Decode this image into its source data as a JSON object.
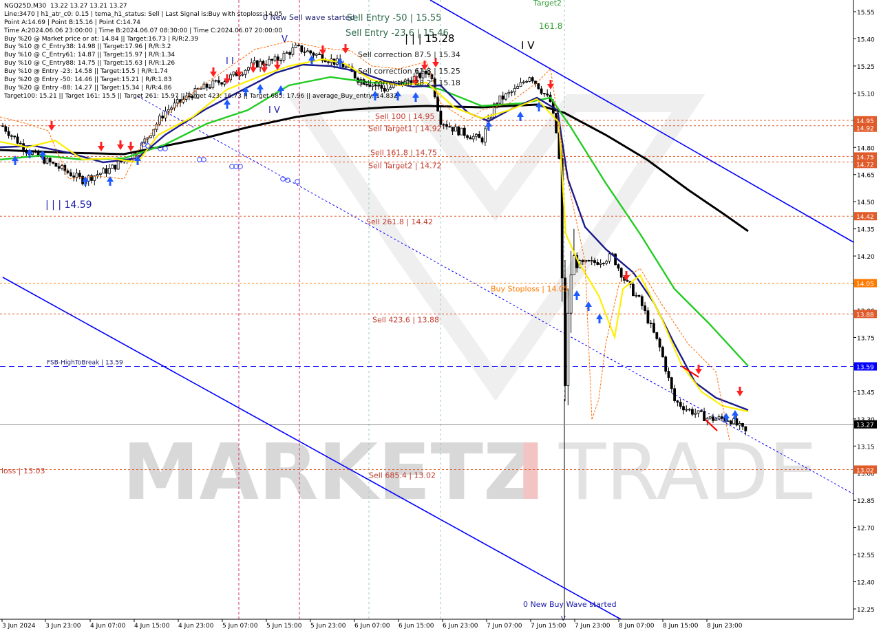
{
  "header": {
    "symbol": "NGQ25D,M30",
    "ohlc": "13.22 13.27 13.21 13.27",
    "lines": [
      "Line:3470 | h1_atr_c0: 0.15 | tema_h1_status: Sell | Last Signal is:Buy with stoploss:14.05",
      "Point A:14.69 | Point B:15.16 | Point C:14.74",
      "Time A:2024.06.06 23:00:00 | Time B:2024.06.07 08:30:00 | Time C:2024.06.07 20:00:00",
      "Buy %20 @ Market price or at: 14.84 || Target:16.73 | R/R:2.39",
      "Buy %10 @ C_Entry38: 14.98 || Target:17.96 | R/R:3.2",
      "Buy %10 @ C_Entry61: 14.87 || Target:15.97 | R/R:1.34",
      "Buy %10 @ C_Entry88: 14.75 || Target:15.63 | R/R:1.26",
      "Buy %10 @ Entry -23: 14.58 || Target:15.5 | R/R:1.74",
      "Buy %20 @ Entry -50: 14.46 || Target:15.21 | R/R:1.83",
      "Buy %20 @ Entry -88: 14.27 || Target:15.34 | R/R:4.86",
      "Target100: 15.21 || Target 161: 15.5 || Target 261: 15.97 || Target 423: 16.73 || Target 685: 17.96 || average_Buy_entry: 14.832"
    ]
  },
  "watermark": {
    "left": "MARKETZ",
    "i": "I",
    "right": "TRADE"
  },
  "y_axis": {
    "ticks": [
      "15.55",
      "15.40",
      "15.25",
      "15.10",
      "14.95",
      "14.80",
      "14.65",
      "14.50",
      "14.35",
      "14.20",
      "14.05",
      "13.90",
      "13.75",
      "13.60",
      "13.45",
      "13.30",
      "13.15",
      "13.00",
      "12.85",
      "12.70",
      "12.55",
      "12.40",
      "12.25"
    ]
  },
  "x_axis": {
    "ticks": [
      "3 Jun 2024",
      "3 Jun 23:00",
      "4 Jun 07:00",
      "4 Jun 15:00",
      "4 Jun 23:00",
      "5 Jun 07:00",
      "5 Jun 15:00",
      "5 Jun 23:00",
      "6 Jun 07:00",
      "6 Jun 15:00",
      "6 Jun 23:00",
      "7 Jun 07:00",
      "7 Jun 15:00",
      "7 Jun 23:00",
      "8 Jun 07:00",
      "8 Jun 15:00",
      "8 Jun 23:00"
    ]
  },
  "price_tags": [
    {
      "value": 14.95,
      "label": "14.95",
      "color": "#e05a2a"
    },
    {
      "value": 14.92,
      "label": "14.92",
      "color": "#e05a2a"
    },
    {
      "value": 14.75,
      "label": "14.75",
      "color": "#e05a2a"
    },
    {
      "value": 14.72,
      "label": "14.72",
      "color": "#e05a2a"
    },
    {
      "value": 14.42,
      "label": "14.42",
      "color": "#e05a2a"
    },
    {
      "value": 14.05,
      "label": "14.05",
      "color": "#ff7a00"
    },
    {
      "value": 13.88,
      "label": "13.88",
      "color": "#e05a2a"
    },
    {
      "value": 13.59,
      "label": "13.59",
      "color": "#0000ff"
    },
    {
      "value": 13.27,
      "label": "13.27",
      "color": "#000000"
    },
    {
      "value": 13.02,
      "label": "13.02",
      "color": "#e05a2a"
    }
  ],
  "level_labels": [
    {
      "text": "Sell 100 | 14.95",
      "value": 14.95,
      "color": "#c0392b"
    },
    {
      "text": "Sell Target1 | 14.92",
      "value": 14.92,
      "color": "#c0392b"
    },
    {
      "text": "Sell 161.8 | 14.75",
      "value": 14.75,
      "color": "#c0392b"
    },
    {
      "text": "Sell Target2 | 14.72",
      "value": 14.72,
      "color": "#c0392b"
    },
    {
      "text": "Sell 261.8 | 14.42",
      "value": 14.42,
      "color": "#c0392b"
    },
    {
      "text": "Buy Stoploss | 14.05",
      "value": 14.05,
      "color": "#ff7a00"
    },
    {
      "text": "Sell 423.6 | 13.88",
      "value": 13.88,
      "color": "#c0392b"
    },
    {
      "text": "FSB-HighToBreak | 13.59",
      "value": 13.59,
      "color": "#1a1a6e"
    },
    {
      "text": "Sell 685.4 | 13.02",
      "value": 13.02,
      "color": "#c0392b"
    },
    {
      "text": "loss | 13.03",
      "value": 13.03,
      "color": "#c0392b"
    }
  ],
  "annotations": {
    "new_sell_wave": "0 New Sell wave started",
    "sell_entry_50": "Sell Entry -50 | 15.55",
    "sell_entry_23": "Sell Entry -23.6 | 15.46",
    "wave_top": "| | | 15.28",
    "sell_corr_875": "Sell correction 87.5 | 15.34",
    "sell_corr_618": "Sell correction 61.8 | 15.25",
    "sell_corr_382": "Sell correction 38.2 | 15.18",
    "wave_low": "| | | 14.59",
    "wave_iv_top": "I V",
    "wave_iv_mid": "I V",
    "wave_v": "V",
    "wave_ii": "I I",
    "target2": "Target2",
    "fib_1618": "161.8",
    "new_buy_wave": "0 New Buy Wave started"
  },
  "colors": {
    "ema_fast": "#ffee00",
    "ema_mid": "#1a1a8c",
    "ema_slow": "#22cc22",
    "ema_long": "#000000",
    "channel": "#0000ff",
    "sell_level": "#c0392b",
    "buy_arrow": "#1e5bff",
    "sell_arrow": "#ff2020"
  }
}
